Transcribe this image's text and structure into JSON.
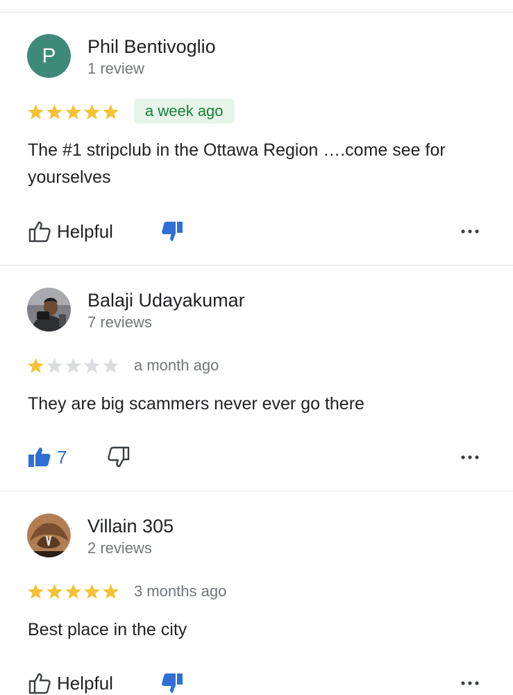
{
  "colors": {
    "star_filled": "#f5c236",
    "star_empty": "#dadce0",
    "accent_blue": "#2f6fd6",
    "badge_bg": "#e6f4ea",
    "badge_text": "#188038",
    "avatar_p": "#3e8a79"
  },
  "reviews": [
    {
      "author": "Phil Bentivoglio",
      "avatar_letter": "P",
      "review_count": "1 review",
      "rating": 5,
      "time": "a week ago",
      "time_highlighted": true,
      "text": "The #1 stripclub in the Ottawa Region ….come see for yourselves",
      "helpful_label": "Helpful",
      "like_count": "",
      "liked": false,
      "disliked": true
    },
    {
      "author": "Balaji Udayakumar",
      "avatar_letter": "",
      "review_count": "7 reviews",
      "rating": 1,
      "time": "a month ago",
      "time_highlighted": false,
      "text": "They are big scammers never ever go there",
      "helpful_label": "",
      "like_count": "7",
      "liked": true,
      "disliked": false
    },
    {
      "author": "Villain 305",
      "avatar_letter": "",
      "review_count": "2 reviews",
      "rating": 5,
      "time": "3 months ago",
      "time_highlighted": false,
      "text": "Best place in the city",
      "helpful_label": "Helpful",
      "like_count": "",
      "liked": false,
      "disliked": true
    }
  ],
  "icons": {
    "thumb_up": "thumb-up-icon",
    "thumb_down": "thumb-down-icon",
    "more": "more-horizontal-icon",
    "star": "star-icon"
  }
}
